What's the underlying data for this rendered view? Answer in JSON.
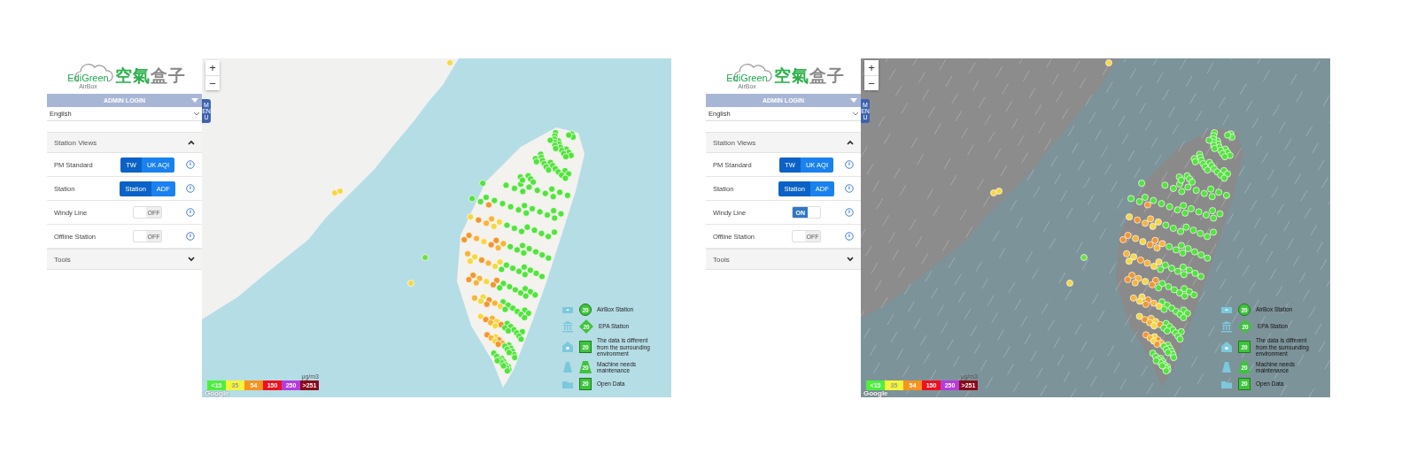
{
  "panels": [
    {
      "logo": {
        "brand": "EdiGreen",
        "sub": "AirBox",
        "title_green": "空氣",
        "title_gray": "盒子"
      },
      "admin_login": "ADMIN LOGIN",
      "language": "English",
      "menu_tab": "MENU",
      "sections": [
        {
          "title": "Station Views",
          "expanded": true,
          "rows": [
            {
              "label": "PM Standard",
              "kind": "segmented",
              "options": [
                {
                  "label": "TW",
                  "selected": true
                },
                {
                  "label": "UK AQI",
                  "selected": false
                }
              ]
            },
            {
              "label": "Station",
              "kind": "segmented",
              "options": [
                {
                  "label": "Station",
                  "selected": true
                },
                {
                  "label": "ADF",
                  "selected": false
                }
              ]
            },
            {
              "label": "Windy Line",
              "kind": "toggle",
              "on": false,
              "state_label": "OFF"
            },
            {
              "label": "Offline Station",
              "kind": "toggle",
              "on": false,
              "state_label": "OFF"
            }
          ]
        },
        {
          "title": "Tools",
          "expanded": false
        }
      ],
      "zoom": [
        "+",
        "−"
      ],
      "legend": [
        {
          "kind": "airbox",
          "badge": "20",
          "label": "AirBox Station"
        },
        {
          "kind": "epa",
          "badge": "20",
          "label": "EPA Station"
        },
        {
          "kind": "different",
          "badge": "20",
          "label": "The data is different from the surrounding environment"
        },
        {
          "kind": "maintenance",
          "badge": "20",
          "label": "Machine needs maintenance"
        },
        {
          "kind": "open",
          "badge": "20",
          "label": "Open Data"
        }
      ],
      "scale": {
        "unit": "μg/m3",
        "steps": [
          {
            "label": "<15",
            "color": "#4cf03c"
          },
          {
            "label": "35",
            "color": "#f5f53a"
          },
          {
            "label": "54",
            "color": "#f7931e"
          },
          {
            "label": "150",
            "color": "#f0101e"
          },
          {
            "label": "250",
            "color": "#b43ce0"
          },
          {
            "label": ">251",
            "color": "#8a0a1a"
          }
        ]
      },
      "attribution": "Google"
    },
    {
      "logo": {
        "brand": "EdiGreen",
        "sub": "AirBox",
        "title_green": "空氣",
        "title_gray": "盒子"
      },
      "admin_login": "ADMIN LOGIN",
      "language": "English",
      "menu_tab": "MENU",
      "sections": [
        {
          "title": "Station Views",
          "expanded": true,
          "rows": [
            {
              "label": "PM Standard",
              "kind": "segmented",
              "options": [
                {
                  "label": "TW",
                  "selected": true
                },
                {
                  "label": "UK AQI",
                  "selected": false
                }
              ]
            },
            {
              "label": "Station",
              "kind": "segmented",
              "options": [
                {
                  "label": "Station",
                  "selected": true
                },
                {
                  "label": "ADF",
                  "selected": false
                }
              ]
            },
            {
              "label": "Windy Line",
              "kind": "toggle",
              "on": true,
              "state_label": "ON"
            },
            {
              "label": "Offline Station",
              "kind": "toggle",
              "on": false,
              "state_label": "OFF"
            }
          ]
        },
        {
          "title": "Tools",
          "expanded": false
        }
      ],
      "zoom": [
        "+",
        "−"
      ],
      "legend": [
        {
          "kind": "airbox",
          "badge": "20",
          "label": "AirBox Station"
        },
        {
          "kind": "epa",
          "badge": "20",
          "label": "EPA Station"
        },
        {
          "kind": "different",
          "badge": "20",
          "label": "The data is different from the surrounding environment"
        },
        {
          "kind": "maintenance",
          "badge": "20",
          "label": "Machine needs maintenance"
        },
        {
          "kind": "open",
          "badge": "20",
          "label": "Open Data"
        }
      ],
      "scale": {
        "unit": "μg/m3",
        "steps": [
          {
            "label": "<15",
            "color": "#4cf03c"
          },
          {
            "label": "35",
            "color": "#f5f53a"
          },
          {
            "label": "54",
            "color": "#f7931e"
          },
          {
            "label": "150",
            "color": "#f0101e"
          },
          {
            "label": "250",
            "color": "#b43ce0"
          },
          {
            "label": ">251",
            "color": "#8a0a1a"
          }
        ]
      },
      "attribution": "Google"
    }
  ]
}
